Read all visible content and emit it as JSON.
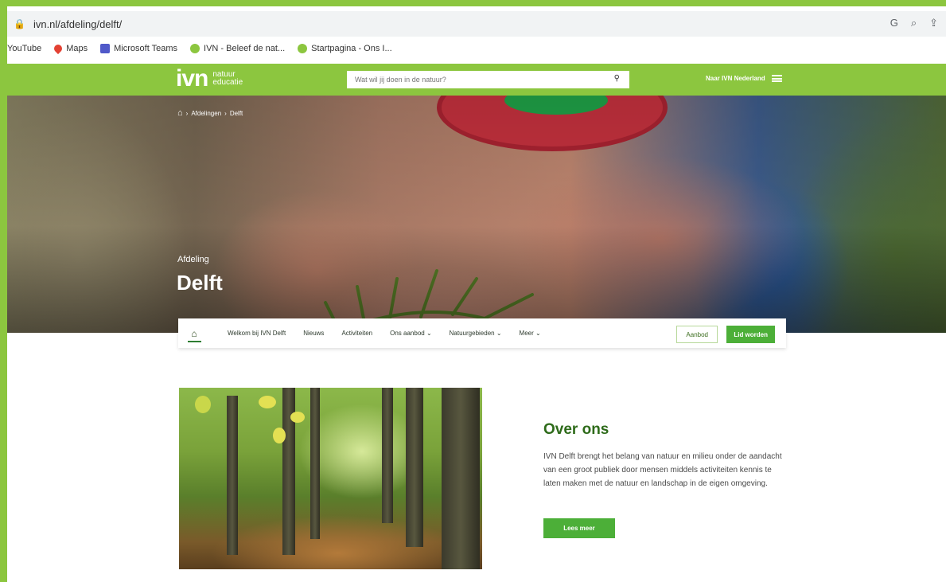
{
  "browser": {
    "url": "ivn.nl/afdeling/delft/",
    "bookmarks": [
      {
        "label": "YouTube",
        "icon": "youtube-icon"
      },
      {
        "label": "Maps",
        "icon": "maps-pin-icon"
      },
      {
        "label": "Microsoft Teams",
        "icon": "teams-icon"
      },
      {
        "label": "IVN - Beleef de nat...",
        "icon": "ivn-favicon-icon"
      },
      {
        "label": "Startpagina - Ons I...",
        "icon": "ivn-favicon-icon"
      }
    ],
    "right_icons": [
      "G",
      "⌕",
      "⇪"
    ]
  },
  "header": {
    "logo_main": "ivn",
    "logo_sub_1": "natuur",
    "logo_sub_2": "educatie",
    "search_placeholder": "Wat wil jij doen in de natuur?",
    "naar_link": "Naar IVN Nederland",
    "brand_color": "#8cc63f"
  },
  "hero": {
    "breadcrumb": [
      "Afdelingen",
      "Delft"
    ],
    "kicker": "Afdeling",
    "title": "Delft"
  },
  "subnav": {
    "items": [
      {
        "label": "Welkom bij IVN Delft",
        "has_dropdown": false
      },
      {
        "label": "Nieuws",
        "has_dropdown": false
      },
      {
        "label": "Activiteiten",
        "has_dropdown": false
      },
      {
        "label": "Ons aanbod",
        "has_dropdown": true
      },
      {
        "label": "Natuurgebieden",
        "has_dropdown": true
      },
      {
        "label": "Meer",
        "has_dropdown": true
      }
    ],
    "aanbod_button": "Aanbod",
    "lid_button": "Lid worden"
  },
  "content": {
    "title": "Over ons",
    "text": "IVN Delft brengt het belang van natuur en milieu onder de aandacht van een groot publiek door mensen middels activiteiten kennis te laten maken met de natuur en landschap in de eigen omgeving.",
    "button": "Lees meer"
  }
}
